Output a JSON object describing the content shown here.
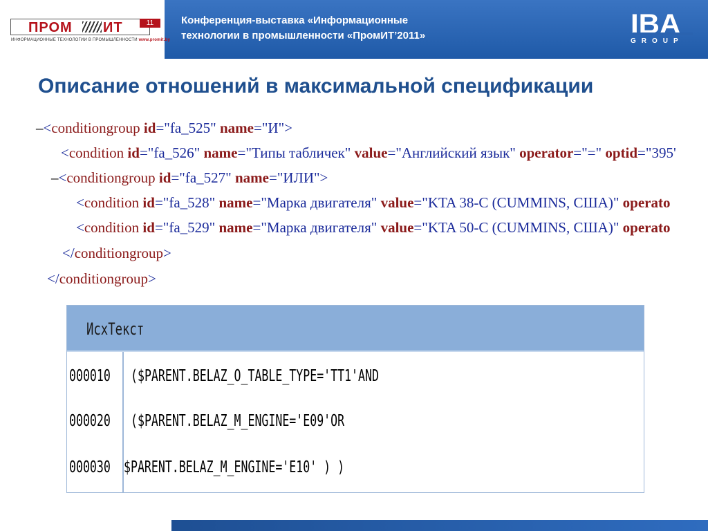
{
  "header": {
    "logo": {
      "name_part1": "ПРОМ",
      "name_part2": "ИТ",
      "badge": "11",
      "subtitle": "ИНФОРМАЦИОННЫЕ ТЕХНОЛОГИИ В ПРОМЫШЛЕННОСТИ",
      "url": "www.promit.by"
    },
    "conference_line1": "Конференция-выставка «Информационные",
    "conference_line2": "технологии в промышленности «ПромИТ’2011»",
    "brand_main": "IBA",
    "brand_sub": "GROUP"
  },
  "title": "Описание отношений в максимальной спецификации",
  "xml_lines": [
    {
      "minus": "–",
      "html_parts": [
        {
          "t": "<",
          "c": "punc"
        },
        {
          "t": "conditiongroup",
          "c": "tag"
        },
        {
          "t": " id",
          "c": "attr"
        },
        {
          "t": "=\"fa_525\"",
          "c": "val"
        },
        {
          "t": " name",
          "c": "attr"
        },
        {
          "t": "=\"И\">",
          "c": "val"
        }
      ]
    },
    {
      "minus": "",
      "html_parts": [
        {
          "t": "<",
          "c": "punc"
        },
        {
          "t": "condition",
          "c": "tag"
        },
        {
          "t": " id",
          "c": "attr"
        },
        {
          "t": "=\"fa_526\"",
          "c": "val"
        },
        {
          "t": " name",
          "c": "attr"
        },
        {
          "t": "=\"Типы табличек\"",
          "c": "val"
        },
        {
          "t": " value",
          "c": "attr"
        },
        {
          "t": "=\"Английский язык\"",
          "c": "val"
        },
        {
          "t": " operator",
          "c": "attr"
        },
        {
          "t": "=\"=\"",
          "c": "val"
        },
        {
          "t": " optid",
          "c": "attr"
        },
        {
          "t": "=\"395'",
          "c": "val"
        }
      ]
    },
    {
      "minus": "–",
      "html_parts": [
        {
          "t": "<",
          "c": "punc"
        },
        {
          "t": "conditiongroup",
          "c": "tag"
        },
        {
          "t": " id",
          "c": "attr"
        },
        {
          "t": "=\"fa_527\"",
          "c": "val"
        },
        {
          "t": " name",
          "c": "attr"
        },
        {
          "t": "=\"ИЛИ\">",
          "c": "val"
        }
      ]
    },
    {
      "minus": "",
      "html_parts": [
        {
          "t": "<",
          "c": "punc"
        },
        {
          "t": "condition",
          "c": "tag"
        },
        {
          "t": " id",
          "c": "attr"
        },
        {
          "t": "=\"fa_528\"",
          "c": "val"
        },
        {
          "t": " name",
          "c": "attr"
        },
        {
          "t": "=\"Марка двигателя\"",
          "c": "val"
        },
        {
          "t": " value",
          "c": "attr"
        },
        {
          "t": "=\"KTA 38-C (CUMMINS, США)\"",
          "c": "val"
        },
        {
          "t": " operato",
          "c": "attr"
        }
      ]
    },
    {
      "minus": "",
      "html_parts": [
        {
          "t": "<",
          "c": "punc"
        },
        {
          "t": "condition",
          "c": "tag"
        },
        {
          "t": " id",
          "c": "attr"
        },
        {
          "t": "=\"fa_529\"",
          "c": "val"
        },
        {
          "t": " name",
          "c": "attr"
        },
        {
          "t": "=\"Марка двигателя\"",
          "c": "val"
        },
        {
          "t": " value",
          "c": "attr"
        },
        {
          "t": "=\"KTA 50-C (CUMMINS, США)\"",
          "c": "val"
        },
        {
          "t": " operato",
          "c": "attr"
        }
      ]
    },
    {
      "minus": "",
      "html_parts": [
        {
          "t": "</",
          "c": "punc"
        },
        {
          "t": "conditiongroup",
          "c": "tag"
        },
        {
          "t": ">",
          "c": "punc"
        }
      ]
    },
    {
      "minus": "",
      "html_parts": [
        {
          "t": "</",
          "c": "punc"
        },
        {
          "t": "conditiongroup",
          "c": "tag"
        },
        {
          "t": ">",
          "c": "punc"
        }
      ]
    }
  ],
  "source_table": {
    "header": "ИсхТекст",
    "rows": [
      {
        "num": "000010",
        "code": "($PARENT.BELAZ_O_TABLE_TYPE='TT1'AND"
      },
      {
        "num": "000020",
        "code": "($PARENT.BELAZ_M_ENGINE='E09'OR"
      },
      {
        "num": "000030",
        "code": "$PARENT.BELAZ_M_ENGINE='E10' ) )"
      }
    ]
  },
  "colors": {
    "header_blue": "#2a63b0",
    "title_blue": "#1f4f8e",
    "tag_red": "#8b1a1a",
    "value_blue": "#1a2a9a",
    "panel_head": "#8aaed9"
  }
}
